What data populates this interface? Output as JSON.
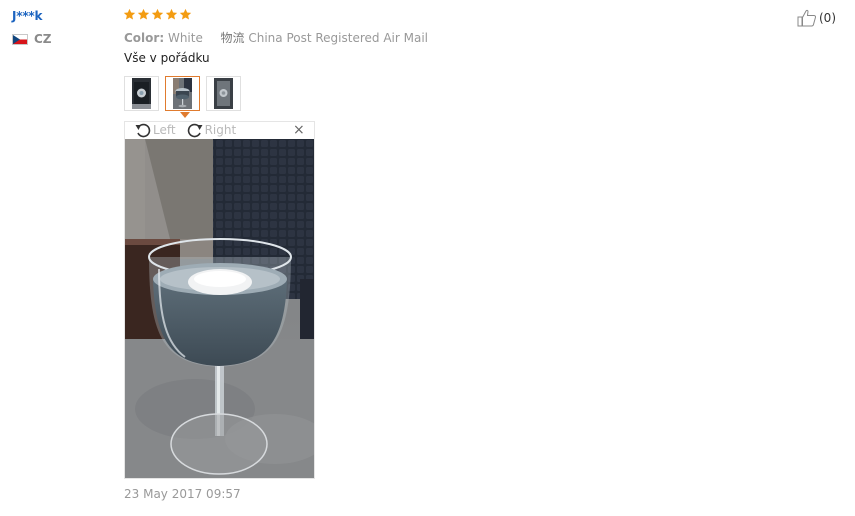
{
  "reviewer": {
    "name": "J***k",
    "country": "CZ",
    "flag_icon": "czech-flag-icon"
  },
  "rating": {
    "stars": 5,
    "max": 5,
    "color": "#f39c12"
  },
  "like": {
    "icon": "thumbs-up-icon",
    "count": "(0)"
  },
  "meta": {
    "color_label": "Color:",
    "color_value": "White",
    "logistics_label": "物流",
    "logistics_value": "China Post Registered Air Mail"
  },
  "review_text": "Vše v pořádku",
  "thumbnails": [
    {
      "name": "photo-1",
      "active": false
    },
    {
      "name": "photo-2",
      "active": true
    },
    {
      "name": "photo-3",
      "active": false
    }
  ],
  "viewer": {
    "rotate_left_label": "Left",
    "rotate_right_label": "Right",
    "close_label": "×",
    "accent_color": "#e07b2e"
  },
  "date": "23 May 2017 09:57"
}
